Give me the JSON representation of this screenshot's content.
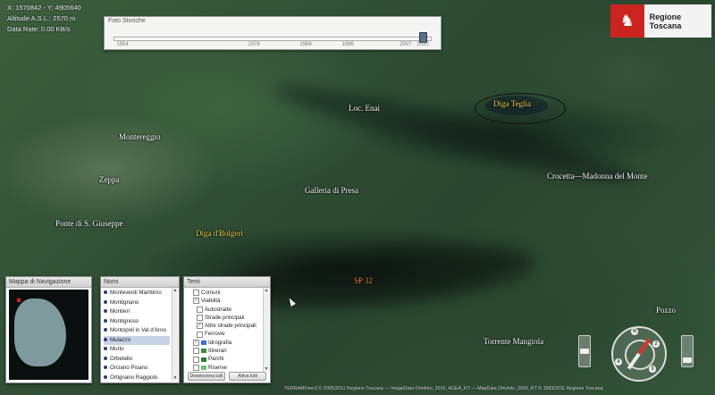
{
  "coords": {
    "xy": "X: 1570842 - Y: 4905640",
    "altitude": "Altitude A.S.L.: 2570 m",
    "data_rate": "Data Rate: 0.00 KB/s"
  },
  "timeline": {
    "title": "Foto Storiche",
    "ticks": [
      "1954",
      "1978",
      "1988",
      "1996",
      "2007",
      "2010"
    ],
    "selected_year": "2010"
  },
  "logo": {
    "name": "Regione Toscana"
  },
  "labels": {
    "diga_teglia": "Diga Teglia",
    "loc_enai": "Loc. Enai",
    "montereggio": "Montereggio",
    "zeppa": "Zeppa",
    "galleria": "Galleria di Presa",
    "crocetta": "Crocetta—Madonna del Monte",
    "ponte": "Ponte di S. Giuseppe",
    "diga_bolgeri": "Diga  d'Bolgeri",
    "sp32": "SP 32",
    "pozzo": "Pozzo",
    "torrente": "Torrente Mangiola"
  },
  "nav_panel": {
    "title": "Mappa di Navigazione"
  },
  "names_panel": {
    "title": "Nomi",
    "items": [
      "Monteverdi Marittimo",
      "Montignano",
      "Montieri",
      "Montignoso",
      "Montopoli in Val d'Arno",
      "Mulazzo",
      "Murlo",
      "Orbetello",
      "Orciano Pisano",
      "Ortignano Raggiolo"
    ],
    "selected": "Mulazzo"
  },
  "temi_panel": {
    "title": "Temi",
    "items": [
      {
        "label": "Comuni",
        "level": 0,
        "checked": false,
        "color": ""
      },
      {
        "label": "Viabilità",
        "level": 0,
        "checked": true,
        "color": ""
      },
      {
        "label": "Autostrade",
        "level": 1,
        "checked": false,
        "color": ""
      },
      {
        "label": "Strade principali",
        "level": 1,
        "checked": false,
        "color": ""
      },
      {
        "label": "Altre strade principali",
        "level": 1,
        "checked": true,
        "color": ""
      },
      {
        "label": "Ferrovie",
        "level": 1,
        "checked": false,
        "color": ""
      },
      {
        "label": "Idrografia",
        "level": 0,
        "checked": true,
        "color": "#3a6fd6"
      },
      {
        "label": "Itinerari",
        "level": 0,
        "checked": false,
        "color": "#3a8a3a"
      },
      {
        "label": "Parchi",
        "level": 0,
        "checked": false,
        "color": "#2e7d2e"
      },
      {
        "label": "Riserve",
        "level": 0,
        "checked": false,
        "color": "#6fc26f"
      }
    ],
    "deselect_label": "Deseleziona tutti",
    "activate_label": "Attiva tutti"
  },
  "footer": "TERRAMFiver2 © 2005/2011 Regione Toscana — ImageData Ortofoto_2010_AGEA_RT — MapData Ortofoto_2009_RT © 1983/2011 Regione Toscana"
}
